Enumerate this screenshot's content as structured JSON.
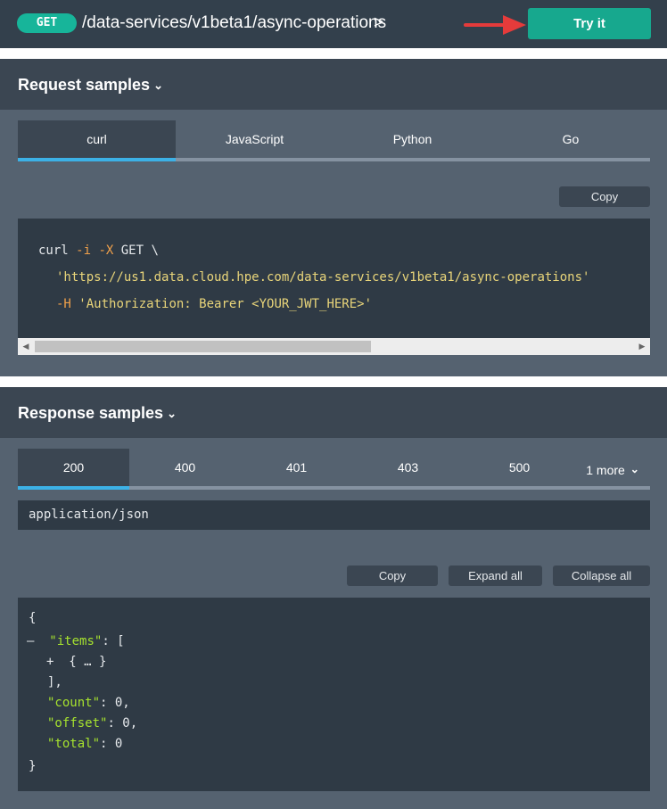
{
  "endpoint": {
    "method": "GET",
    "path": "/data-services/v1beta1/async-operations",
    "chevron": ">",
    "try_label": "Try it"
  },
  "request_samples": {
    "title": "Request samples",
    "chevron": "⌄",
    "tabs": [
      "curl",
      "JavaScript",
      "Python",
      "Go"
    ],
    "active_tab": "curl",
    "copy_label": "Copy",
    "code": {
      "line1": {
        "cmd": "curl",
        "flags": "-i -X",
        "verb": "GET \\"
      },
      "line2": {
        "url": "'https://us1.data.cloud.hpe.com/data-services/v1beta1/async-operations'"
      },
      "line3": {
        "flag": "-H",
        "header": "'Authorization: Bearer <YOUR_JWT_HERE>'"
      }
    }
  },
  "response_samples": {
    "title": "Response samples",
    "chevron": "⌄",
    "tabs": [
      "200",
      "400",
      "401",
      "403",
      "500"
    ],
    "more_label": "1 more",
    "more_chevron": "⌄",
    "active_tab": "200",
    "content_type": "application/json",
    "copy_label": "Copy",
    "expand_label": "Expand all",
    "collapse_label": "Collapse all",
    "json": {
      "open_brace": "{",
      "collapse_toggle": "–",
      "items_key": "\"items\"",
      "items_open": ": [",
      "expand_toggle": "+",
      "items_collapsed": "{ … }",
      "items_close": "],",
      "count_key": "\"count\"",
      "count_value": ": 0,",
      "offset_key": "\"offset\"",
      "offset_value": ": 0,",
      "total_key": "\"total\"",
      "total_value": ": 0",
      "close_brace": "}"
    }
  },
  "colors": {
    "accent_green": "#17a88e",
    "active_tab_underline": "#3cb1e6",
    "annotation_arrow": "#e53b3b"
  }
}
